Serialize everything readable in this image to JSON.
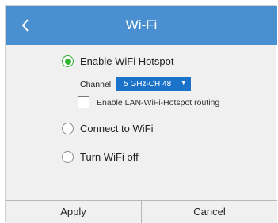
{
  "header": {
    "title": "Wi-Fi",
    "back_icon": "chevron-left-icon",
    "color": "#4a90d0"
  },
  "options": [
    {
      "label": "Enable WiFi Hotspot",
      "selected": true
    },
    {
      "label": "Connect to WiFi",
      "selected": false
    },
    {
      "label": "Turn WiFi off",
      "selected": false
    }
  ],
  "hotspot": {
    "channel_label": "Channel",
    "channel_value": "5 GHz-CH 48",
    "routing_label": "Enable LAN-WiFi-Hotspot routing",
    "routing_checked": false
  },
  "footer": {
    "apply_label": "Apply",
    "cancel_label": "Cancel"
  },
  "colors": {
    "radio_selected": "#2fb52f",
    "select_bg": "#1a73c8"
  }
}
